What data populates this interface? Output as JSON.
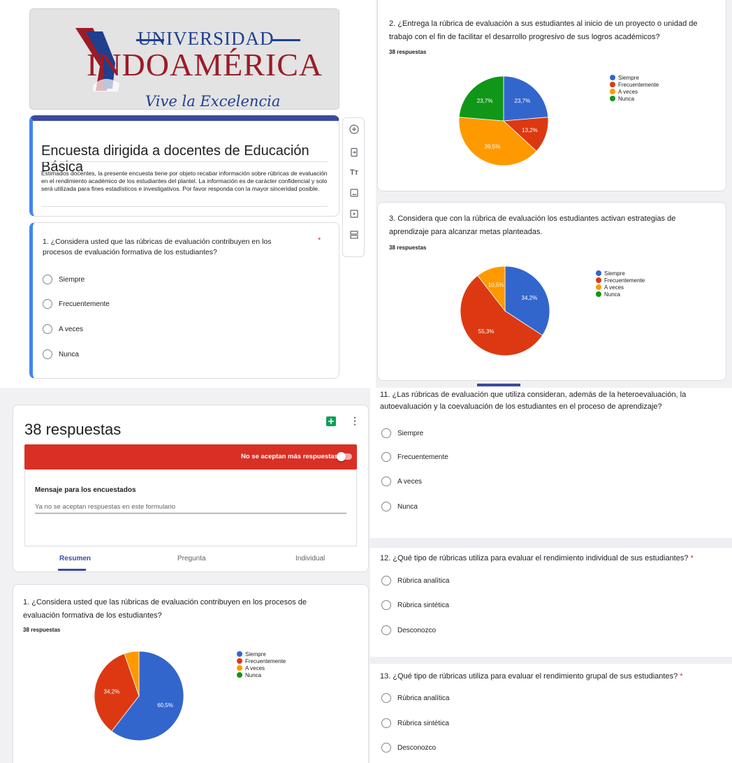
{
  "colors": {
    "blue": "#3366cc",
    "red": "#dc3912",
    "orange": "#ff9900",
    "green": "#109618",
    "accent": "#3c4a9e"
  },
  "form": {
    "logo": {
      "top": "UNIVERSIDAD",
      "main": "INDOAMÉRICA",
      "tagline": "Vive la Excelencia"
    },
    "title": "Encuesta dirigida a docentes de Educación Básica",
    "description": "Estimados docentes, la presente encuesta tiene por objeto recabar información sobre rúbricas de evaluación en el rendimiento académico de los estudiantes del plantel. La información es de carácter confidencial y solo será utilizada para fines estadísticos e investigativos. Por favor responda con la mayor sinceridad posible.",
    "question1": {
      "text": "1. ¿Considera usted que las rúbricas de evaluación contribuyen en los procesos de evaluación formativa de los estudiantes?",
      "required": "*",
      "options": [
        "Siempre",
        "Frecuentemente",
        "A veces",
        "Nunca"
      ]
    },
    "sidebar_icons": [
      "add-question-icon",
      "import-questions-icon",
      "add-title-icon",
      "add-image-icon",
      "add-video-icon",
      "add-section-icon"
    ]
  },
  "q2_card": {
    "title": "2. ¿Entrega la rúbrica de evaluación a sus estudiantes al inicio de un proyecto o unidad de trabajo con el fin de facilitar el desarrollo progresivo de sus logros académicos?",
    "responses": "38 respuestas"
  },
  "q3_card": {
    "title": "3. Considera que con la rúbrica de evaluación los estudiantes activan estrategias de aprendizaje para alcanzar metas planteadas.",
    "responses": "38 respuestas"
  },
  "responses_panel": {
    "header": "38 respuestas",
    "banner": "No se aceptan más respuestas",
    "message_label": "Mensaje para los encuestados",
    "message_value": "Ya no se aceptan respuestas en este formulario",
    "tabs": [
      "Resumen",
      "Pregunta",
      "Individual"
    ],
    "q1_title": "1. ¿Considera usted que las rúbricas de evaluación contribuyen en los procesos de evaluación formativa de los estudiantes?",
    "q1_responses": "38 respuestas"
  },
  "legend": [
    "Siempre",
    "Frecuentemente",
    "A veces",
    "Nunca"
  ],
  "questions_right": {
    "q11": {
      "text": "11.  ¿Las rúbricas de evaluación que utiliza consideran, además de la heteroevaluación,  la autoevaluación y la coevaluación de los estudiantes en el proceso de aprendizaje?",
      "options": [
        "Siempre",
        "Frecuentemente",
        "A veces",
        "Nunca"
      ]
    },
    "q12": {
      "text": "12.  ¿Qué tipo de rúbricas utiliza para evaluar el rendimiento individual de sus estudiantes?",
      "required": "*",
      "options": [
        "Rúbrica analítica",
        "Rúbrica sintética",
        "Desconozco"
      ]
    },
    "q13": {
      "text": "13.  ¿Qué tipo de rúbricas utiliza para evaluar el rendimiento grupal de sus estudiantes?",
      "required": "*",
      "options": [
        "Rúbrica analítica",
        "Rúbrica sintética",
        "Desconozco"
      ]
    }
  },
  "chart_data": [
    {
      "type": "pie",
      "title": "2. ¿Entrega la rúbrica de evaluación a sus estudiantes al inicio de un proyecto o unidad de trabajo con el fin de facilitar el desarrollo progresivo de sus logros académicos?",
      "categories": [
        "Siempre",
        "Frecuentemente",
        "A veces",
        "Nunca"
      ],
      "values": [
        23.7,
        13.2,
        39.5,
        23.7
      ],
      "labels": [
        "23,7%",
        "13,2%",
        "39,5%",
        "23,7%"
      ],
      "legend": "right"
    },
    {
      "type": "pie",
      "title": "3. Considera que con la rúbrica de evaluación los estudiantes activan estrategias de aprendizaje para alcanzar metas planteadas.",
      "categories": [
        "Siempre",
        "Frecuentemente",
        "A veces",
        "Nunca"
      ],
      "values": [
        34.2,
        55.3,
        10.5,
        0
      ],
      "labels": [
        "34,2%",
        "55,3%",
        "10,5%",
        ""
      ],
      "legend": "right"
    },
    {
      "type": "pie",
      "title": "1. ¿Considera usted que las rúbricas de evaluación contribuyen en los procesos de evaluación formativa de los estudiantes?",
      "categories": [
        "Siempre",
        "Frecuentemente",
        "A veces",
        "Nunca"
      ],
      "values": [
        60.5,
        34.2,
        5.3,
        0
      ],
      "labels": [
        "60,5%",
        "34,2%",
        "",
        ""
      ],
      "legend": "right"
    }
  ]
}
